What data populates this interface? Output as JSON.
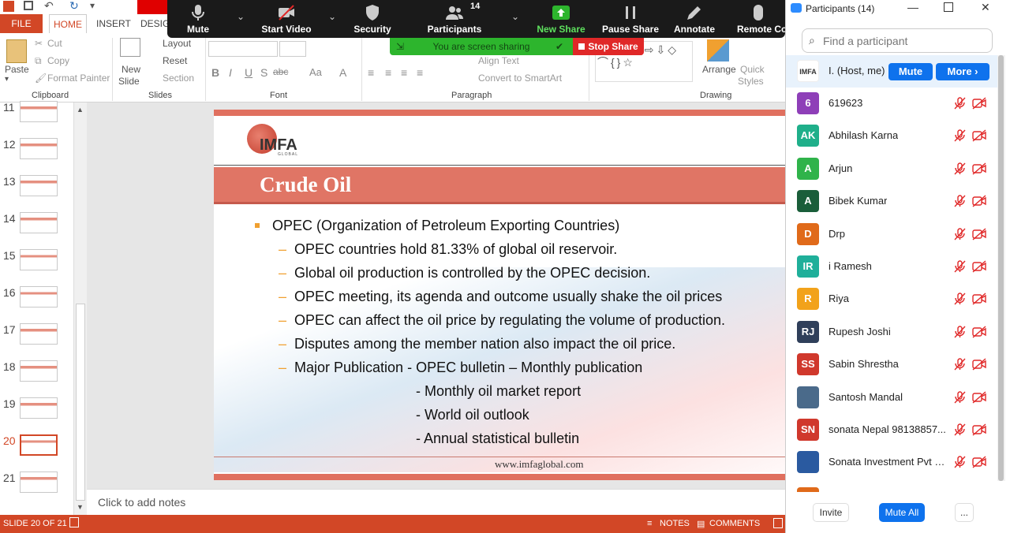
{
  "colors": {
    "accent": "#d24726",
    "zoom_green": "#2db52d",
    "zoom_red": "#e02828",
    "zoom_blue": "#0e72ed",
    "slide_band": "#e07565"
  },
  "ribbon_tabs": {
    "file": "FILE",
    "home": "HOME",
    "insert": "INSERT",
    "design": "DESIG"
  },
  "ribbon": {
    "clipboard": {
      "paste": "Paste",
      "cut": "Cut",
      "copy": "Copy",
      "format_painter": "Format Painter",
      "label": "Clipboard"
    },
    "slides": {
      "new_slide_1": "New",
      "new_slide_2": "Slide",
      "layout": "Layout",
      "reset": "Reset",
      "section": "Section",
      "label": "Slides"
    },
    "font": {
      "label": "Font"
    },
    "paragraph": {
      "align_text": "Align Text",
      "convert_smartart": "Convert to SmartArt",
      "label": "Paragraph"
    },
    "drawing": {
      "arrange": "Arrange",
      "quick_styles_1": "Quick",
      "quick_styles_2": "Styles",
      "label": "Drawing"
    }
  },
  "zoom_toolbar": {
    "mute": "Mute",
    "start_video": "Start Video",
    "security": "Security",
    "participants": "Participants",
    "participants_count": "14",
    "new_share": "New Share",
    "pause_share": "Pause Share",
    "annotate": "Annotate",
    "remote_control": "Remote Co",
    "sharing_status": "You are screen sharing",
    "stop_share": "Stop Share"
  },
  "thumbnails": [
    {
      "num": "11"
    },
    {
      "num": "12"
    },
    {
      "num": "13"
    },
    {
      "num": "14"
    },
    {
      "num": "15"
    },
    {
      "num": "16"
    },
    {
      "num": "17"
    },
    {
      "num": "18"
    },
    {
      "num": "19"
    },
    {
      "num": "20",
      "selected": true
    },
    {
      "num": "21"
    }
  ],
  "slide": {
    "logo": "IMFA",
    "logo_sub": "GLOBAL",
    "title": "Crude Oil",
    "bullet_main": "OPEC (Organization of Petroleum Exporting Countries)",
    "sub_bullets": [
      "OPEC countries hold 81.33% of global oil reservoir.",
      "Global oil production is controlled by the OPEC decision.",
      "OPEC meeting, its agenda and outcome usually shake the oil prices",
      "OPEC can affect the oil price by regulating the volume of production.",
      "Disputes among the member nation also impact the oil price.",
      "Major Publication - OPEC bulletin – Monthly publication"
    ],
    "continuation": [
      "- Monthly oil market report",
      "- World oil outlook",
      "- Annual statistical bulletin"
    ],
    "footer": "www.imfaglobal.com"
  },
  "notes_placeholder": "Click to add notes",
  "status": {
    "slide_info": "SLIDE 20 OF 21",
    "notes": "NOTES",
    "comments": "COMMENTS"
  },
  "participants": {
    "title": "Participants (14)",
    "search_placeholder": "Find a participant",
    "host": {
      "avatar": "IMFA",
      "name": "I. (Host, me)",
      "mute": "Mute",
      "more": "More"
    },
    "list": [
      {
        "initials": "6",
        "name": "619623",
        "color": "#8e3fb8"
      },
      {
        "initials": "AK",
        "name": "Abhilash Karna",
        "color": "#1faf8a"
      },
      {
        "initials": "A",
        "name": "Arjun",
        "color": "#2fb34a"
      },
      {
        "initials": "A",
        "name": "Bibek Kumar",
        "color": "#1a5e3a"
      },
      {
        "initials": "D",
        "name": "Drp",
        "color": "#e06a1a"
      },
      {
        "initials": "IR",
        "name": "i  Ramesh",
        "color": "#1faf9a"
      },
      {
        "initials": "R",
        "name": "Riya",
        "color": "#f2a21a"
      },
      {
        "initials": "RJ",
        "name": "Rupesh Joshi",
        "color": "#2f3f5a"
      },
      {
        "initials": "SS",
        "name": "Sabin Shrestha",
        "color": "#d0382c"
      },
      {
        "initials": "",
        "name": "Santosh Mandal",
        "color": "#4a6a8a"
      },
      {
        "initials": "SN",
        "name": "sonata  Nepal 98138857...",
        "color": "#d0382c"
      },
      {
        "initials": "",
        "name": "Sonata Investment Pvt Ltd",
        "color": "#2a5aa0"
      }
    ],
    "invite": "Invite",
    "mute_all": "Mute All",
    "more_options": "..."
  }
}
